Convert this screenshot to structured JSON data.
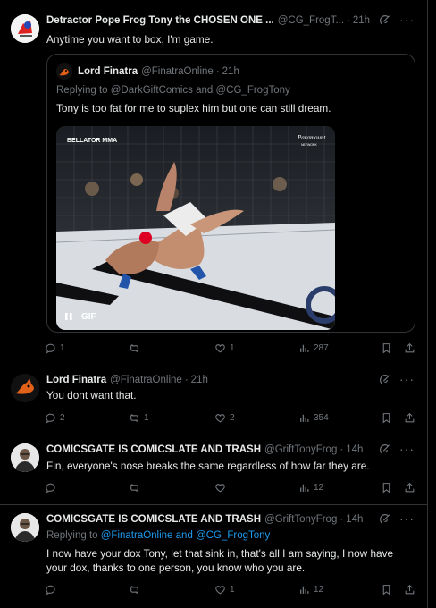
{
  "tweet1": {
    "name": "Detractor Pope Frog Tony the CHOSEN ONE ...",
    "handle": "@CG_FrogT...",
    "time": "21h",
    "text": "Anytime you want to box, I'm game.",
    "quote": {
      "name": "Lord Finatra",
      "handle": "@FinatraOnline",
      "time": "21h",
      "replying_prefix": "Replying to",
      "replying_to": "@DarkGiftComics and @CG_FrogTony",
      "text": "Tony is too fat for me to suplex him but one can still dream.",
      "media": {
        "brand_left": "BELLATOR MMA",
        "brand_right": "Paramount",
        "brand_right_sub": "NETWORK",
        "badge": "GIF"
      }
    },
    "actions": {
      "replies": "1",
      "retweets": "",
      "likes": "1",
      "views": "287"
    }
  },
  "tweet2": {
    "name": "Lord Finatra",
    "handle": "@FinatraOnline",
    "time": "21h",
    "text": "You dont want that.",
    "actions": {
      "replies": "2",
      "retweets": "1",
      "likes": "2",
      "views": "354"
    }
  },
  "tweet3": {
    "name": "COMICSGATE IS COMICSLATE AND TRASH",
    "handle": "@GriftTonyFrog",
    "time": "14h",
    "text": "Fin, everyone's nose breaks the same regardless of how far they are.",
    "actions": {
      "replies": "",
      "retweets": "",
      "likes": "",
      "views": "12"
    }
  },
  "tweet4": {
    "name": "COMICSGATE IS COMICSLATE AND TRASH",
    "handle": "@GriftTonyFrog",
    "time": "14h",
    "replying_prefix": "Replying to",
    "replying_to": "@FinatraOnline and @CG_FrogTony",
    "text": "I now have your dox Tony, let that sink in, that's all I am saying, I now have your dox, thanks to one person, you know who you are.",
    "actions": {
      "replies": "",
      "retweets": "",
      "likes": "1",
      "views": "12"
    }
  },
  "colors": {
    "bg": "#000000",
    "text": "#e7e9ea",
    "muted": "#71767b",
    "link": "#1d9bf0",
    "border": "#2f3336"
  },
  "icons": [
    "reply-icon",
    "retweet-icon",
    "like-icon",
    "views-icon",
    "bookmark-icon",
    "share-icon",
    "grok-icon",
    "more-icon",
    "pause-icon"
  ]
}
